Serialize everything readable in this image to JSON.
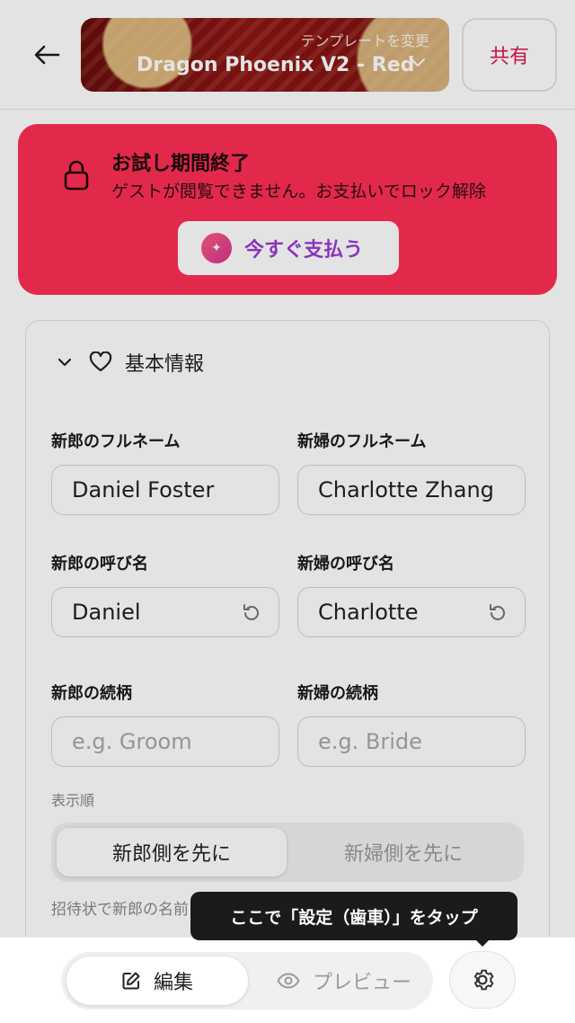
{
  "header": {
    "template_hint": "テンプレートを変更",
    "template_name": "Dragon Phoenix V2 - Red",
    "share_label": "共有"
  },
  "trial": {
    "title": "お試し期間終了",
    "message": "ゲストが閲覧できません。お支払いでロック解除",
    "pay_label": "今すぐ支払う"
  },
  "basic_info": {
    "title": "基本情報",
    "groom_fullname_label": "新郎のフルネーム",
    "groom_fullname": "Daniel Foster",
    "bride_fullname_label": "新婦のフルネーム",
    "bride_fullname": "Charlotte Zhang",
    "groom_nick_label": "新郎の呼び名",
    "groom_nick": "Daniel",
    "bride_nick_label": "新婦の呼び名",
    "bride_nick": "Charlotte",
    "groom_relation_label": "新郎の続柄",
    "groom_relation_placeholder": "e.g. Groom",
    "bride_relation_label": "新婦の続柄",
    "bride_relation_placeholder": "e.g. Bride",
    "order_label": "表示順",
    "order_groom_first": "新郎側を先に",
    "order_bride_first": "新婦側を先に",
    "hint_text": "招待状で新郎の名前"
  },
  "bottom": {
    "edit_label": "編集",
    "preview_label": "プレビュー"
  },
  "tooltip": {
    "text": "ここで「設定（歯車）」をタップ"
  },
  "colors": {
    "banner": "#ff2f55",
    "share": "#e0164c",
    "pay_text": "#9c3bd6"
  }
}
